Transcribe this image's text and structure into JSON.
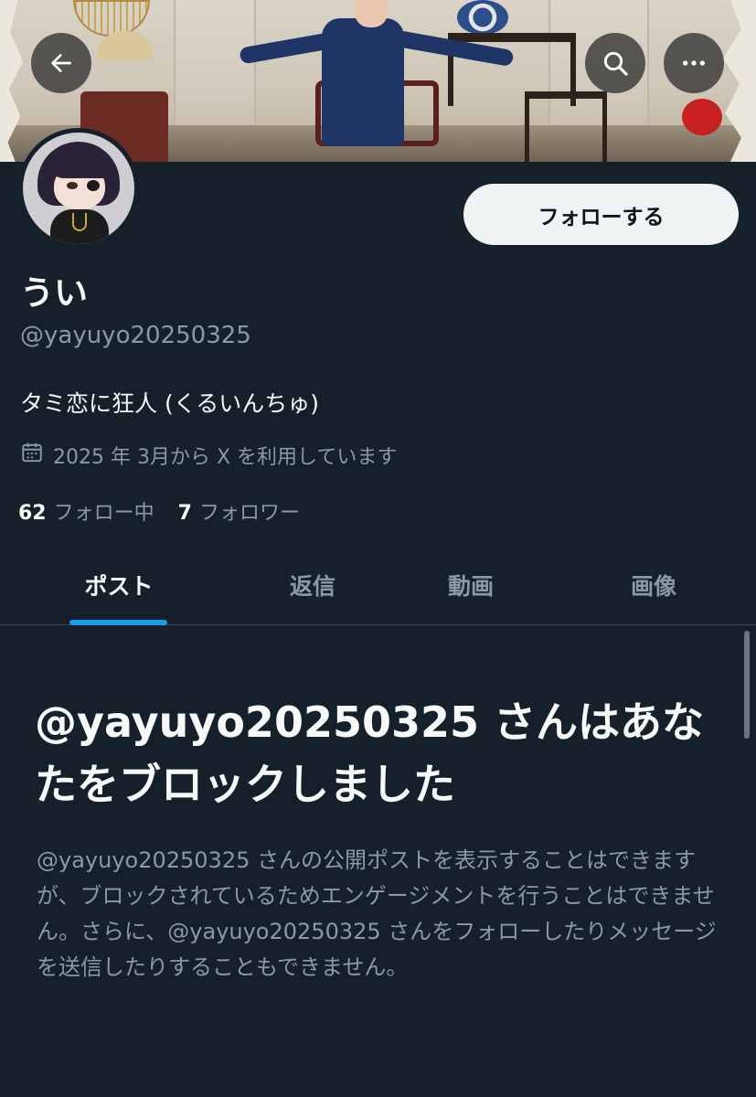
{
  "profile": {
    "display_name": "うい",
    "handle": "@yayuyo20250325",
    "bio": "タミ恋に狂人 (くるいんちゅ)",
    "joined": "2025 年 3月から X を利用しています",
    "following_count": "62",
    "following_label": "フォロー中",
    "followers_count": "7",
    "followers_label": "フォロワー"
  },
  "actions": {
    "follow_label": "フォローする"
  },
  "icons": {
    "back": "arrow-left-icon",
    "search": "search-icon",
    "more": "more-horizontal-icon",
    "calendar": "calendar-icon"
  },
  "tabs": [
    {
      "label": "ポスト",
      "active": true
    },
    {
      "label": "返信",
      "active": false
    },
    {
      "label": "動画",
      "active": false
    },
    {
      "label": "画像",
      "active": false
    }
  ],
  "blocked": {
    "title": "@yayuyo20250325 さんはあなたをブロックしました",
    "body": "@yayuyo20250325 さんの公開ポストを表示することはできますが、ブロックされているためエンゲージメントを行うことはできません。さらに、@yayuyo20250325 さんをフォローしたりメッセージを送信したりすることもできません。"
  },
  "colors": {
    "background": "#15202b",
    "accent": "#1d9bf0",
    "primary_text": "#f7f9f9",
    "secondary_text": "#8b98a5",
    "divider": "#38444d",
    "follow_button_bg": "#eff3f4"
  }
}
